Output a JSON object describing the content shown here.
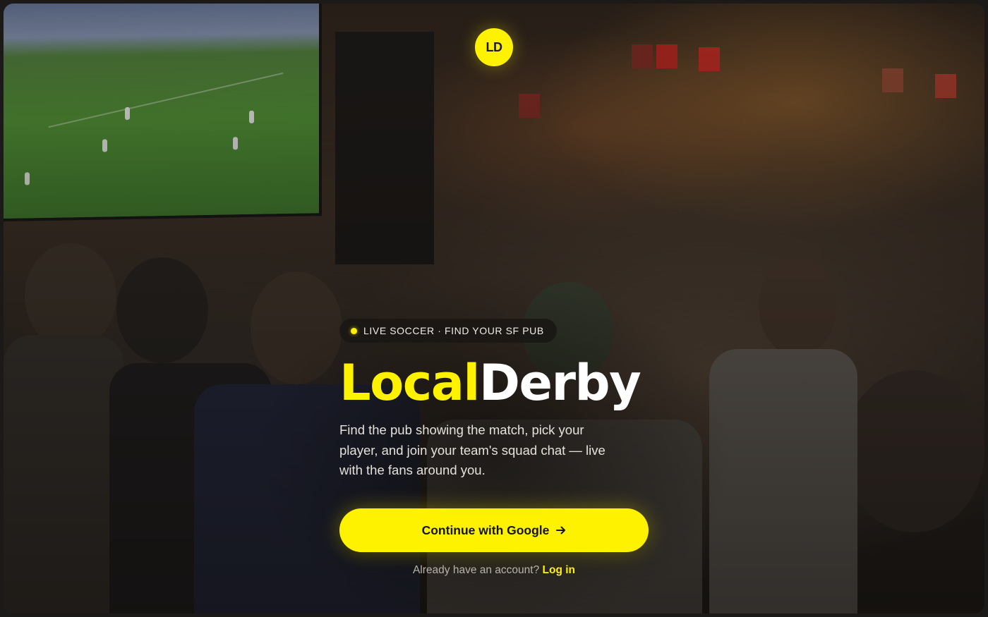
{
  "logo": {
    "text": "LD"
  },
  "badge": {
    "label": "LIVE SOCCER · FIND YOUR SF PUB"
  },
  "brand": {
    "part1": "Local",
    "part2": "Derby"
  },
  "tagline": "Find the pub showing the match, pick your player, and join your team's squad chat — live with the fans around you.",
  "cta": {
    "label": "Continue with Google",
    "icon": "arrow-right-icon"
  },
  "login": {
    "prompt": "Already have an account?",
    "link_label": "Log in"
  },
  "colors": {
    "accent": "#fff200",
    "text_primary": "#ffffff",
    "text_muted": "#b9b3ab",
    "background": "#1b1a18"
  }
}
